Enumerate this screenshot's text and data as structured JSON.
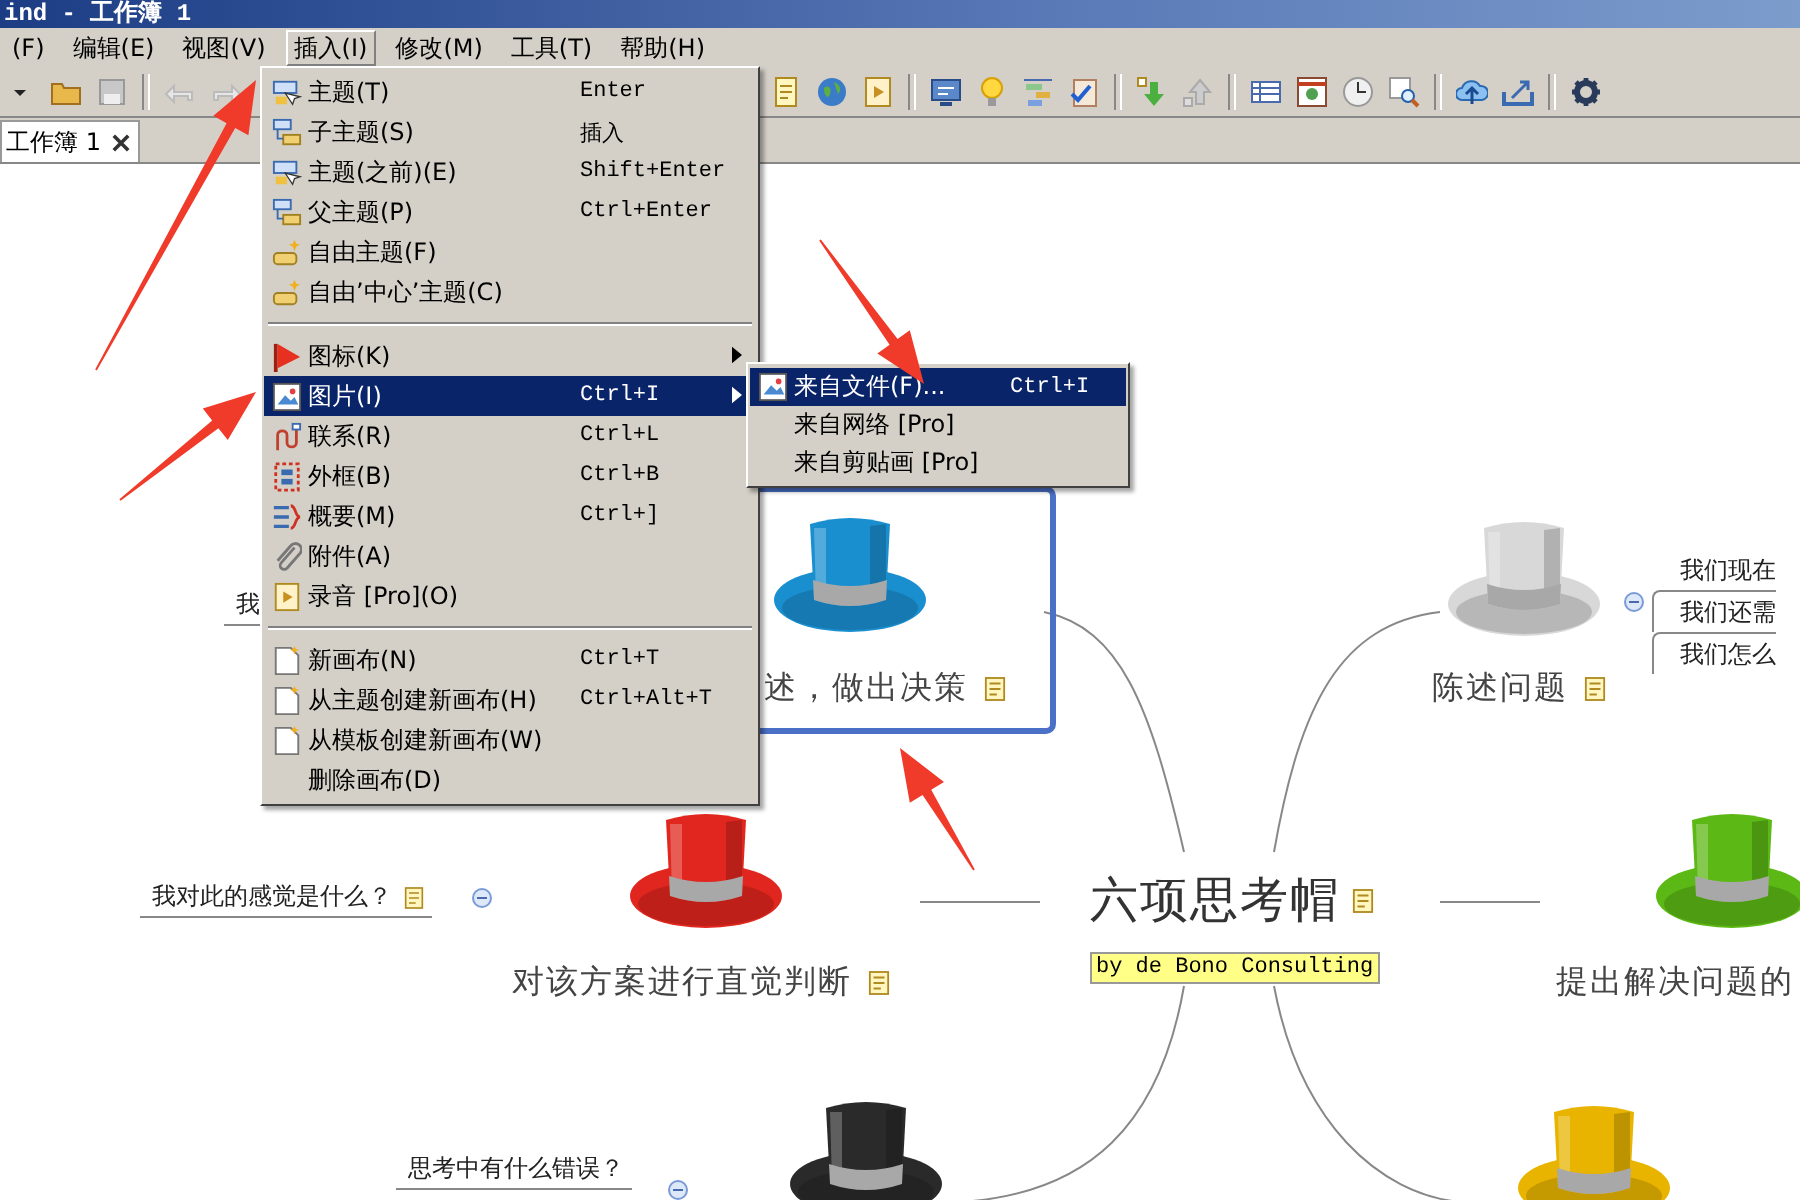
{
  "window": {
    "title": "ind - 工作簿 1"
  },
  "menubar": [
    {
      "label": "(F)",
      "selected": false
    },
    {
      "label": "编辑(E)",
      "selected": false
    },
    {
      "label": "视图(V)",
      "selected": false
    },
    {
      "label": "插入(I)",
      "selected": true
    },
    {
      "label": "修改(M)",
      "selected": false
    },
    {
      "label": "工具(T)",
      "selected": false
    },
    {
      "label": "帮助(H)",
      "selected": false
    }
  ],
  "tabs": [
    {
      "label": "工作簿 1",
      "selected": true
    }
  ],
  "insert_menu": {
    "items": [
      {
        "kind": "item",
        "label": "主题(T)",
        "shortcut": "Enter",
        "selected": false
      },
      {
        "kind": "item",
        "label": "子主题(S)",
        "shortcut": "插入",
        "selected": false
      },
      {
        "kind": "item",
        "label": "主题(之前)(E)",
        "shortcut": "Shift+Enter",
        "selected": false
      },
      {
        "kind": "item",
        "label": "父主题(P)",
        "shortcut": "Ctrl+Enter",
        "selected": false
      },
      {
        "kind": "item",
        "label": "自由主题(F)",
        "selected": false
      },
      {
        "kind": "item",
        "label": "自由’中心’主题(C)",
        "selected": false
      },
      {
        "kind": "separator"
      },
      {
        "kind": "item",
        "label": "图标(K)",
        "submenu": true,
        "selected": false
      },
      {
        "kind": "item",
        "label": "图片(I)",
        "shortcut": "Ctrl+I",
        "submenu": true,
        "selected": true
      },
      {
        "kind": "item",
        "label": "联系(R)",
        "shortcut": "Ctrl+L",
        "selected": false
      },
      {
        "kind": "item",
        "label": "外框(B)",
        "shortcut": "Ctrl+B",
        "selected": false
      },
      {
        "kind": "item",
        "label": "概要(M)",
        "shortcut": "Ctrl+]",
        "selected": false
      },
      {
        "kind": "item",
        "label": "附件(A)",
        "selected": false
      },
      {
        "kind": "item",
        "label": "录音 [Pro](O)",
        "selected": false
      },
      {
        "kind": "separator"
      },
      {
        "kind": "item",
        "label": "新画布(N)",
        "shortcut": "Ctrl+T",
        "selected": false
      },
      {
        "kind": "item",
        "label": "从主题创建新画布(H)",
        "shortcut": "Ctrl+Alt+T",
        "selected": false
      },
      {
        "kind": "item",
        "label": "从模板创建新画布(W)",
        "selected": false
      },
      {
        "kind": "item",
        "label": "删除画布(D)",
        "selected": false
      }
    ]
  },
  "image_submenu": {
    "items": [
      {
        "label": "来自文件(F)...",
        "shortcut": "Ctrl+I",
        "selected": true
      },
      {
        "label": "来自网络 [Pro]",
        "selected": false
      },
      {
        "label": "来自剪贴画 [Pro]",
        "selected": false
      }
    ]
  },
  "mind_map": {
    "central": {
      "title": "六项思考帽",
      "has_note": true,
      "subtitle": "by de Bono Consulting"
    },
    "branches": [
      {
        "color": "#1a8fd0",
        "label": "述，做出决策",
        "has_note": true,
        "selected": true,
        "subtopics": [
          {
            "label": "我"
          }
        ]
      },
      {
        "color": "#d8d8d8",
        "label": "陈述问题",
        "has_note": true,
        "selected": false,
        "subtopics": [
          {
            "label": "我们现在"
          },
          {
            "label": "我们还需"
          },
          {
            "label": "我们怎么"
          }
        ]
      },
      {
        "color": "#e0261e",
        "label": "对该方案进行直觉判断",
        "has_note": true,
        "selected": false,
        "subtopics": [
          {
            "label": "我对此的感觉是什么？",
            "has_note": true
          }
        ]
      },
      {
        "color": "#5cb814",
        "label": "提出解决问题的",
        "has_note": false,
        "selected": false
      },
      {
        "color": "#2a2a2a",
        "selected": false,
        "subtopics": [
          {
            "label": "思考中有什么错误？"
          }
        ]
      },
      {
        "color": "#e8b400",
        "selected": false
      }
    ]
  }
}
